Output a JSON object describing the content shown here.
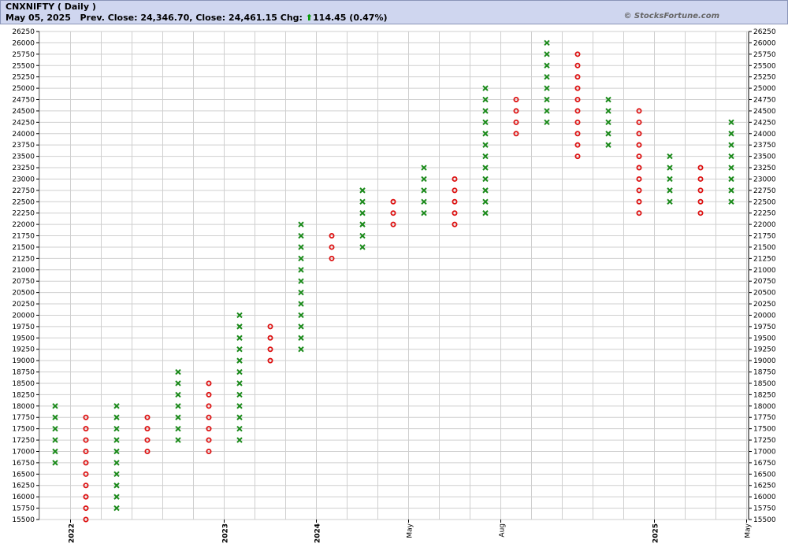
{
  "header": {
    "title": "CNXNIFTY ( Daily )",
    "date": "May 05, 2025",
    "prev_close_label": "Prev. Close:",
    "prev_close": "24,346.70,",
    "close_label": "Close:",
    "close": "24,461.15",
    "chg_label": "Chg:",
    "chg": "114.45 (0.47%)",
    "watermark": "© StocksFortune.com"
  },
  "colors": {
    "x": "#1a8a1a",
    "o": "#dd1111",
    "header_bg": "#cfd6ef",
    "grid": "#cfcfcf"
  },
  "icons": {
    "change_direction": "up-arrow-icon"
  },
  "chart_data": {
    "type": "point-and-figure",
    "box_size": 250,
    "ylim": [
      15500,
      26250
    ],
    "y_ticks": [
      15500,
      15750,
      16000,
      16250,
      16500,
      16750,
      17000,
      17250,
      17500,
      17750,
      18000,
      18250,
      18500,
      18750,
      19000,
      19250,
      19500,
      19750,
      20000,
      20250,
      20500,
      20750,
      21000,
      21250,
      21500,
      21750,
      22000,
      22250,
      22500,
      22750,
      23000,
      23250,
      23500,
      23750,
      24000,
      24250,
      24500,
      24750,
      25000,
      25250,
      25500,
      25750,
      26000,
      26250
    ],
    "x_labels": [
      {
        "label": "2022",
        "after_column": 1,
        "bold": true
      },
      {
        "label": "2023",
        "after_column": 6,
        "bold": true
      },
      {
        "label": "2024",
        "after_column": 9,
        "bold": true
      },
      {
        "label": "May",
        "after_column": 12,
        "bold": false
      },
      {
        "label": "Aug",
        "after_column": 15,
        "bold": false
      },
      {
        "label": "2025",
        "after_column": 20,
        "bold": true
      },
      {
        "label": "May",
        "after_column": 23,
        "bold": false
      }
    ],
    "columns": [
      {
        "type": "X",
        "low": 16750,
        "high": 18000
      },
      {
        "type": "O",
        "low": 15500,
        "high": 17750
      },
      {
        "type": "X",
        "low": 15750,
        "high": 18000
      },
      {
        "type": "O",
        "low": 17000,
        "high": 17750
      },
      {
        "type": "X",
        "low": 17250,
        "high": 18750
      },
      {
        "type": "O",
        "low": 17000,
        "high": 18500
      },
      {
        "type": "X",
        "low": 17250,
        "high": 20000
      },
      {
        "type": "O",
        "low": 19000,
        "high": 19750
      },
      {
        "type": "X",
        "low": 19250,
        "high": 22000
      },
      {
        "type": "O",
        "low": 21250,
        "high": 21750
      },
      {
        "type": "X",
        "low": 21500,
        "high": 22750
      },
      {
        "type": "O",
        "low": 22000,
        "high": 22500
      },
      {
        "type": "X",
        "low": 22250,
        "high": 23250
      },
      {
        "type": "O",
        "low": 22000,
        "high": 23000
      },
      {
        "type": "X",
        "low": 22250,
        "high": 25000
      },
      {
        "type": "O",
        "low": 24000,
        "high": 24750
      },
      {
        "type": "X",
        "low": 24250,
        "high": 26000
      },
      {
        "type": "O",
        "low": 23500,
        "high": 25750
      },
      {
        "type": "X",
        "low": 23750,
        "high": 24750
      },
      {
        "type": "O",
        "low": 22250,
        "high": 24500
      },
      {
        "type": "X",
        "low": 22500,
        "high": 23500
      },
      {
        "type": "O",
        "low": 22250,
        "high": 23250
      },
      {
        "type": "X",
        "low": 22500,
        "high": 24250
      }
    ]
  }
}
